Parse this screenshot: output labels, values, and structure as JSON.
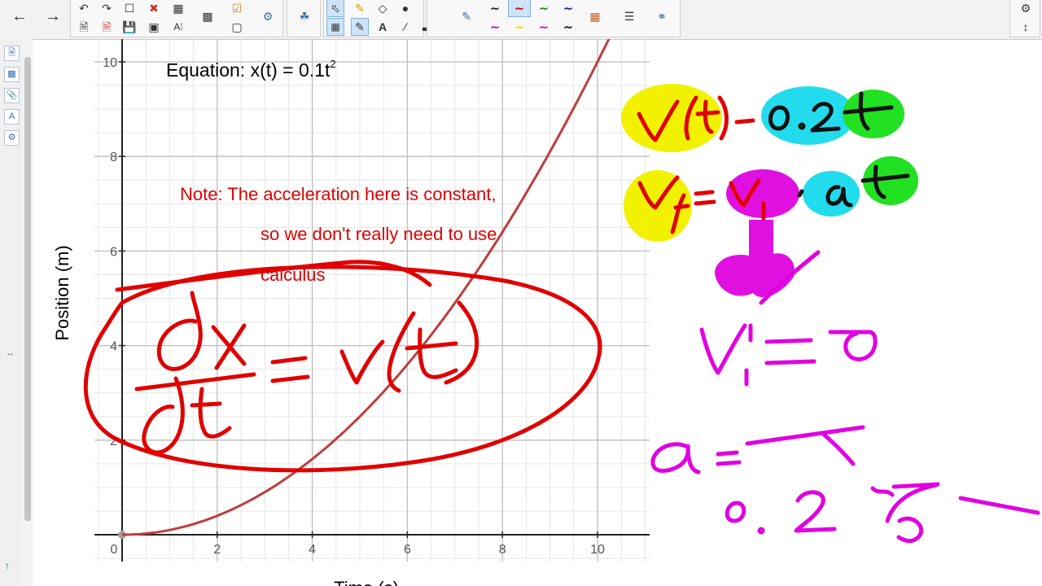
{
  "toolbar": {
    "groups": [
      {
        "name": "history-group",
        "buttons": [
          "undo-icon",
          "redo-icon",
          "new-page-icon",
          "delete-icon",
          "table-icon",
          "previous-page-icon",
          "next-page-icon",
          "save-icon",
          "screen-icon",
          "text-recognition-icon"
        ]
      },
      {
        "name": "capture-group",
        "buttons": [
          "screen-capture-icon",
          "checklist-icon",
          "record-icon",
          "gallery-icon",
          "addons-icon"
        ]
      },
      {
        "name": "tools-group",
        "buttons": [
          "select-icon",
          "pen-icon",
          "shapes-icon",
          "fill-icon",
          "eraser-icon",
          "text-icon",
          "line-icon"
        ]
      },
      {
        "name": "pen-styles-group",
        "buttons": [
          "pen-style-black",
          "pen-style-red",
          "pen-style-green",
          "pen-style-blue",
          "pen-style-magenta",
          "pen-style-yellow",
          "pen-style-pink",
          "pen-style-dark"
        ]
      }
    ],
    "pen_colors": [
      "#222222",
      "#e00000",
      "#1a8a1a",
      "#1a1ab0",
      "#d000d0",
      "#e8e000",
      "#e000e0",
      "#111111"
    ]
  },
  "graph": {
    "equation_prefix": "Equation:  x(t) = 0.1t",
    "equation_exponent": "2",
    "x_axis_label": "Time (s)",
    "y_axis_label": "Position (m)",
    "x_ticks": [
      "0",
      "2",
      "4",
      "6",
      "8",
      "10"
    ],
    "y_ticks": [
      "2",
      "4",
      "6",
      "8",
      "10"
    ],
    "note_lines": [
      "Note:  The acceleration here is constant,",
      "so we don't really need to use",
      "calculus"
    ]
  },
  "chart_data": {
    "type": "line",
    "title": "Equation:  x(t) = 0.1t²",
    "xlabel": "Time (s)",
    "ylabel": "Position (m)",
    "xlim": [
      -0.6,
      11.2
    ],
    "ylim": [
      -0.5,
      10.3
    ],
    "grid": true,
    "series": [
      {
        "x": [
          0,
          1,
          2,
          3,
          4,
          5,
          6,
          7,
          8,
          9,
          10
        ],
        "y": [
          0,
          0.1,
          0.4,
          0.9,
          1.6,
          2.5,
          3.6,
          4.9,
          6.4,
          8.1,
          10
        ]
      }
    ]
  },
  "ink": {
    "red_color": "#e00000",
    "magenta_color": "#e000e0",
    "highlight_yellow": "#f2f200",
    "highlight_cyan": "#22dcee",
    "highlight_green": "#22e022",
    "highlight_magenta": "#e010e0"
  },
  "handwriting": {
    "derivative": "dx/dt = v(t)",
    "velocity_equation": "v(t) = 0.2t",
    "kinematic_equation": "vf = vi + at",
    "initial_velocity": "vi = 0",
    "acceleration": "a = 0.2 m/s"
  }
}
